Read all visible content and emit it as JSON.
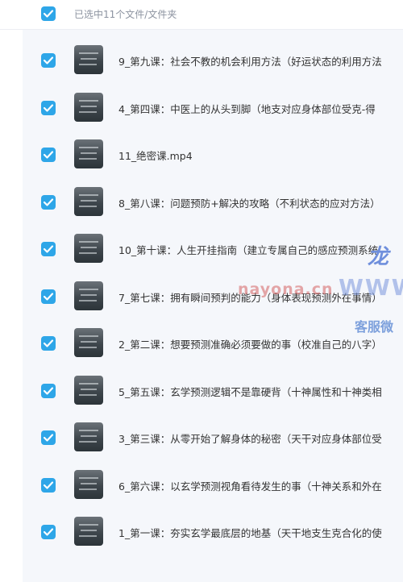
{
  "header": {
    "selection_text": "已选中11个文件/文件夹"
  },
  "files": [
    {
      "title": "9_第九课：社会不教的机会利用方法（好运状态的利用方法"
    },
    {
      "title": "4_第四课：中医上的从头到脚（地支对应身体部位受克-得"
    },
    {
      "title": "11_绝密课.mp4"
    },
    {
      "title": "8_第八课：问题预防+解决的攻略（不利状态的应对方法）"
    },
    {
      "title": "10_第十课：人生开挂指南（建立专属自己的感应预测系统"
    },
    {
      "title": "7_第七课：拥有瞬间预判的能力（身体表现预测外在事情）"
    },
    {
      "title": "2_第二课：想要预测准确必须要做的事（校准自己的八字）"
    },
    {
      "title": "5_第五课：玄学预测逻辑不是靠硬背（十神属性和十神类相"
    },
    {
      "title": "3_第三课：从零开始了解身体的秘密（天干对应身体部位受"
    },
    {
      "title": "6_第六课：以玄学预测视角看待发生的事（十神关系和外在"
    },
    {
      "title": "1_第一课：夯实玄学最底层的地基（天干地支生克合化的使"
    }
  ],
  "watermark": {
    "brand": "龙",
    "url_small": "nayona.cn",
    "url_big": "WWW",
    "service": "客服微"
  },
  "colors": {
    "checkbox": "#2ea6e8",
    "panel_bg": "#f5f7fb",
    "header_text": "#8c93a0",
    "title_text": "#333333"
  },
  "icons": {
    "checkbox": "check-icon"
  }
}
